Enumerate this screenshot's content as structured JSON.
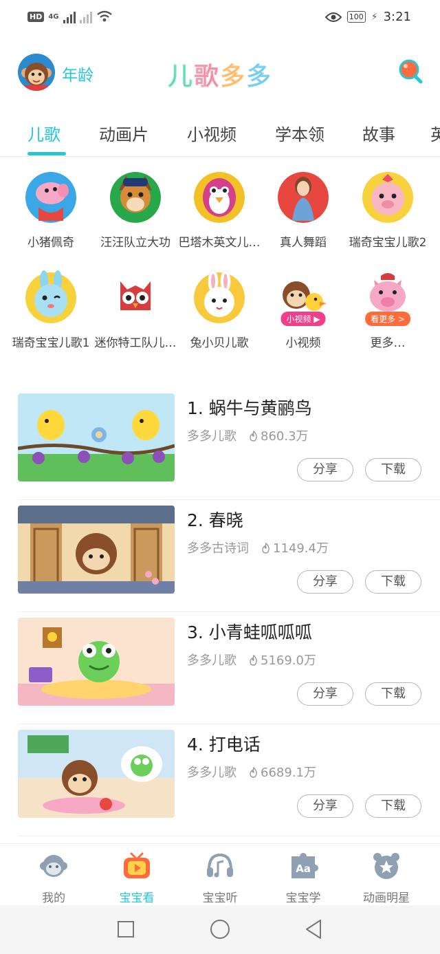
{
  "status_bar": {
    "hd": "HD",
    "network": "4G",
    "battery": "100",
    "time": "3:21"
  },
  "header": {
    "age_label": "年龄",
    "logo_chars": [
      "儿",
      "歌",
      "多",
      "多"
    ],
    "logo_colors": [
      "#2ccf9b",
      "#f25a7d",
      "#ff9f2e",
      "#3cb7ea"
    ]
  },
  "tabs": [
    {
      "label": "儿歌",
      "active": true
    },
    {
      "label": "动画片",
      "active": false
    },
    {
      "label": "小视频",
      "active": false
    },
    {
      "label": "学本领",
      "active": false
    },
    {
      "label": "故事",
      "active": false
    },
    {
      "label": "英",
      "active": false
    }
  ],
  "channels": [
    {
      "label": "小猪佩奇",
      "icon": "peppa-pig-icon",
      "color": "#3aa7e6"
    },
    {
      "label": "汪汪队立大功",
      "icon": "paw-patrol-icon",
      "color": "#28a84a"
    },
    {
      "label": "巴塔木英文儿…",
      "icon": "penguin-icon",
      "color": "#f3c125"
    },
    {
      "label": "真人舞蹈",
      "icon": "dancer-girl-icon",
      "color": "#e8473f"
    },
    {
      "label": "瑞奇宝宝儿歌2",
      "icon": "pig-baby-icon",
      "color": "#f8d23c"
    },
    {
      "label": "瑞奇宝宝儿歌1",
      "icon": "bunny-baby-icon",
      "color": "#f8d23c"
    },
    {
      "label": "迷你特工队儿…",
      "icon": "owl-agent-icon",
      "color": "#ffffff"
    },
    {
      "label": "兔小贝儿歌",
      "icon": "rabbit-icon",
      "color": "#f8c93a"
    },
    {
      "label": "小视频",
      "icon": "monkey-duck-icon",
      "color": "#ffffff",
      "badge": "小视频 ▶"
    },
    {
      "label": "更多…",
      "icon": "pink-pig-icon",
      "color": "#ffffff",
      "badge": "看更多 >"
    }
  ],
  "videos": [
    {
      "title": "1. 蜗牛与黄鹂鸟",
      "channel": "多多儿歌",
      "plays": "860.3万",
      "share": "分享",
      "download": "下载"
    },
    {
      "title": "2. 春晓",
      "channel": "多多古诗词",
      "plays": "1149.4万",
      "share": "分享",
      "download": "下载"
    },
    {
      "title": "3. 小青蛙呱呱呱",
      "channel": "多多儿歌",
      "plays": "5169.0万",
      "share": "分享",
      "download": "下载"
    },
    {
      "title": "4. 打电话",
      "channel": "多多儿歌",
      "plays": "6689.1万",
      "share": "分享",
      "download": "下载"
    }
  ],
  "bottom_nav": [
    {
      "label": "我的",
      "icon": "monkey-face-icon",
      "active": false
    },
    {
      "label": "宝宝看",
      "icon": "tv-play-icon",
      "active": true
    },
    {
      "label": "宝宝听",
      "icon": "headphones-icon",
      "active": false
    },
    {
      "label": "宝宝学",
      "icon": "puzzle-aa-icon",
      "active": false
    },
    {
      "label": "动画明星",
      "icon": "bear-star-icon",
      "active": false
    }
  ],
  "colors": {
    "accent": "#24c7d9",
    "text": "#222222",
    "muted": "#999999"
  }
}
